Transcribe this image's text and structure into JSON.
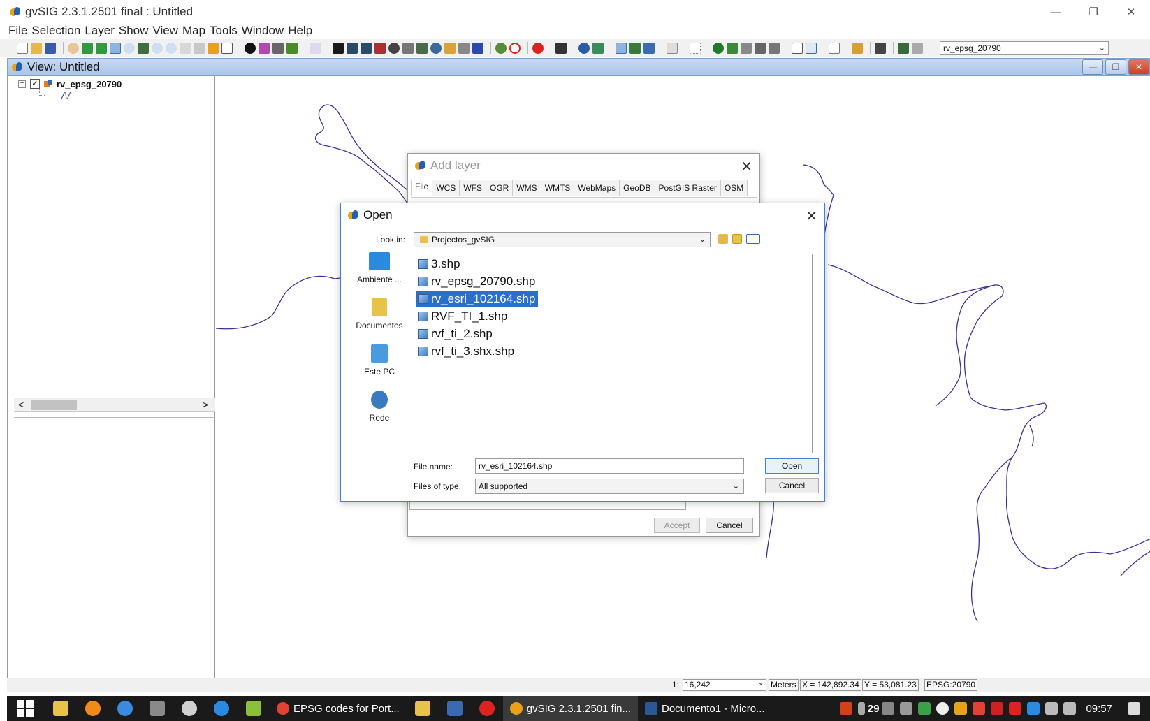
{
  "app": {
    "title": "gvSIG 2.3.1.2501 final : Untitled"
  },
  "window_controls": [
    "—",
    "❐",
    "✕"
  ],
  "menubar": [
    "File",
    "Selection",
    "Layer",
    "Show",
    "View",
    "Map",
    "Tools",
    "Window",
    "Help"
  ],
  "toolbar": {
    "layer_combo_value": "rv_epsg_20790"
  },
  "view": {
    "title": "View: Untitled",
    "toc": {
      "layer_name": "rv_epsg_20790",
      "checked": true,
      "legend_symbol": "/\\/"
    },
    "map_line_color": "#3c2f9a"
  },
  "add_layer_dialog": {
    "title": "Add layer",
    "tabs": [
      "File",
      "WCS",
      "WFS",
      "OGR",
      "WMS",
      "WMTS",
      "WebMaps",
      "GeoDB",
      "PostGIS Raster",
      "OSM"
    ],
    "active_tab": "File",
    "accept_label": "Accept",
    "cancel_label": "Cancel"
  },
  "open_dialog": {
    "title": "Open",
    "look_in_label": "Look in:",
    "look_in_value": "Projectos_gvSIG",
    "places": [
      {
        "label": "Ambiente ..."
      },
      {
        "label": "Documentos"
      },
      {
        "label": "Este PC"
      },
      {
        "label": "Rede"
      }
    ],
    "files": [
      {
        "name": "3.shp",
        "selected": false
      },
      {
        "name": "rv_epsg_20790.shp",
        "selected": false
      },
      {
        "name": "rv_esri_102164.shp",
        "selected": true
      },
      {
        "name": "RVF_TI_1.shp",
        "selected": false
      },
      {
        "name": "rvf_ti_2.shp",
        "selected": false
      },
      {
        "name": "rvf_ti_3.shx.shp",
        "selected": false
      }
    ],
    "file_name_label": "File name:",
    "file_name_value": "rv_esri_102164.shp",
    "files_of_type_label": "Files of type:",
    "files_of_type_value": "All supported",
    "open_label": "Open",
    "cancel_label": "Cancel",
    "selection_color": "#2a6fcc"
  },
  "statusbar": {
    "scale_prefix": "1:",
    "scale_value": "16,242",
    "units": "Meters",
    "x": "X = 142,892.34",
    "y": "Y = 53,081.23",
    "crs": "EPSG:20790"
  },
  "taskbar": {
    "apps": [
      {
        "label": "EPSG codes for Port...",
        "active": false
      },
      {
        "label": "gvSIG 2.3.1.2501 fin...",
        "active": true
      },
      {
        "label": "Documento1 - Micro...",
        "active": false
      }
    ],
    "tray_number": "29",
    "clock": "09:57"
  }
}
